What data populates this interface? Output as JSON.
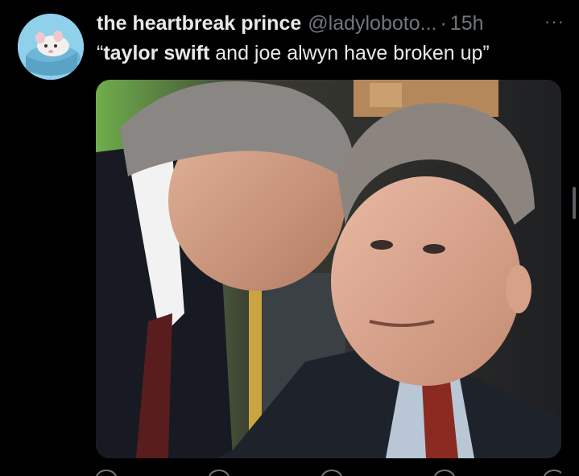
{
  "tweet": {
    "display_name": "the heartbreak prince",
    "handle": "@ladyloboto...",
    "separator": "·",
    "time": "15h",
    "more_label": "···",
    "text_prefix": "“",
    "text_bold": "taylor swift",
    "text_rest": " and joe alwyn have broken up”"
  },
  "media": {
    "description_icon": "photo-image"
  },
  "colors": {
    "background": "#000000",
    "primary_text": "#e7e9ea",
    "secondary_text": "#71767b",
    "avatar_bg": "#8fd0ea"
  }
}
